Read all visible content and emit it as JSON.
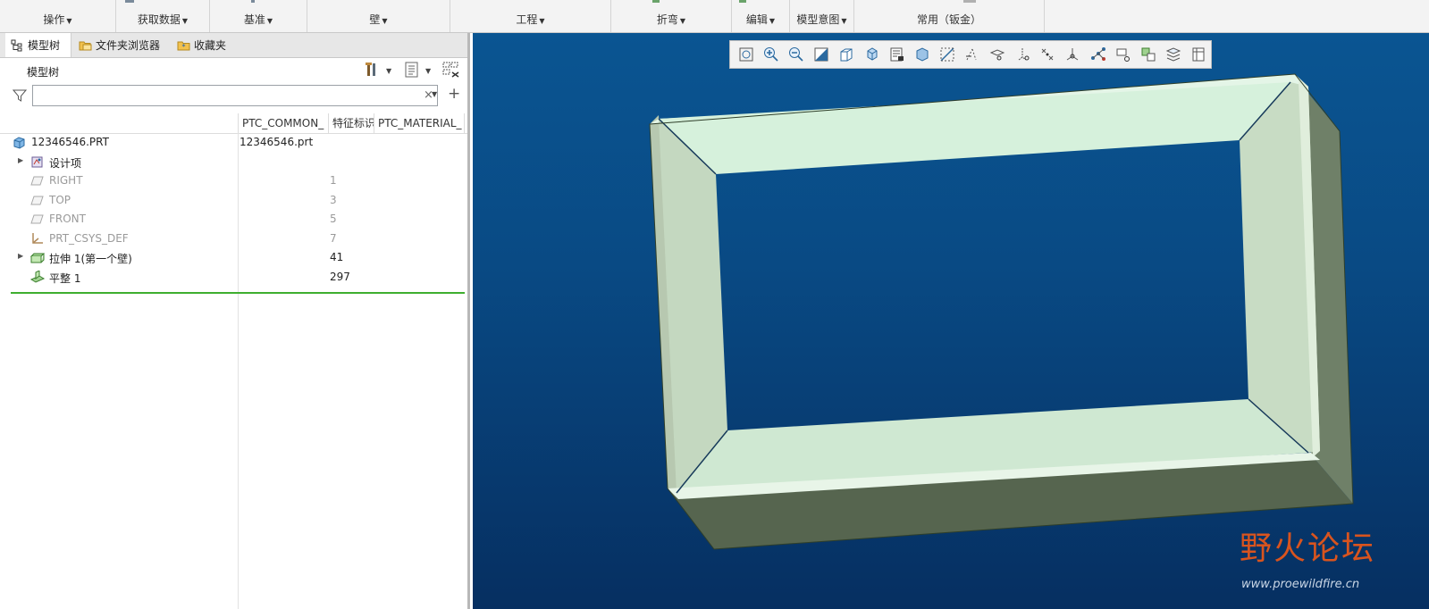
{
  "ribbon": {
    "groups": [
      {
        "label": "操作"
      },
      {
        "label": "获取数据"
      },
      {
        "label": "基准"
      },
      {
        "label": "壁"
      },
      {
        "label": "工程"
      },
      {
        "label": "折弯"
      },
      {
        "label": "编辑"
      },
      {
        "label": "模型意图"
      },
      {
        "label": "常用（钣金）"
      }
    ]
  },
  "left_panel": {
    "tabs": [
      {
        "label": "模型树",
        "icon": "model-tree-icon",
        "active": true
      },
      {
        "label": "文件夹浏览器",
        "icon": "folder-browser-icon",
        "active": false
      },
      {
        "label": "收藏夹",
        "icon": "favorites-icon",
        "active": false
      }
    ],
    "title": "模型树",
    "filter": {
      "value": "",
      "placeholder": ""
    },
    "columns": [
      "PTC_COMMON_",
      "特征标识",
      "PTC_MATERIAL_"
    ],
    "rows": [
      {
        "label": "12346546.PRT",
        "col1": "12346546.prt",
        "col2": "",
        "icon": "part-icon",
        "expandable": false,
        "dim": false
      },
      {
        "label": "设计项",
        "col1": "",
        "col2": "",
        "icon": "design-items-icon",
        "expandable": true,
        "dim": false
      },
      {
        "label": "RIGHT",
        "col1": "",
        "col2": "1",
        "icon": "datum-plane-icon",
        "expandable": false,
        "dim": true
      },
      {
        "label": "TOP",
        "col1": "",
        "col2": "3",
        "icon": "datum-plane-icon",
        "expandable": false,
        "dim": true
      },
      {
        "label": "FRONT",
        "col1": "",
        "col2": "5",
        "icon": "datum-plane-icon",
        "expandable": false,
        "dim": true
      },
      {
        "label": "PRT_CSYS_DEF",
        "col1": "",
        "col2": "7",
        "icon": "csys-icon",
        "expandable": false,
        "dim": true
      },
      {
        "label": "拉伸 1(第一个壁)",
        "col1": "",
        "col2": "41",
        "icon": "extrude-wall-icon",
        "expandable": true,
        "dim": false
      },
      {
        "label": "平整 1",
        "col1": "",
        "col2": "297",
        "icon": "flat-wall-icon",
        "expandable": false,
        "dim": false
      }
    ]
  },
  "viewport": {
    "toolbar_icons": [
      "refit-icon",
      "zoom-in-icon",
      "zoom-out-icon",
      "repaint-icon",
      "saved-orientations-icon",
      "view-manager-icon",
      "perspective-icon",
      "display-style-icon",
      "datum-plane-display-icon",
      "datum-axis-display-icon",
      "datum-point-display-icon",
      "csys-display-icon",
      "annotation-display-icon",
      "spin-center-icon",
      "edge-display-icon",
      "appearance-icon",
      "section-view-icon",
      "layer-icon",
      "sheetmetal-display-icon"
    ]
  },
  "watermark": {
    "title": "野火论坛",
    "url": "www.proewildfire.cn"
  },
  "colors": {
    "viewport_top": "#0a5592",
    "viewport_bottom": "#062f61",
    "model_face_light": "#d6f1dc",
    "model_face_mid": "#aebfa8",
    "model_face_dark": "#56654f",
    "insert_line": "#3fae2f",
    "watermark": "#d9541e"
  }
}
